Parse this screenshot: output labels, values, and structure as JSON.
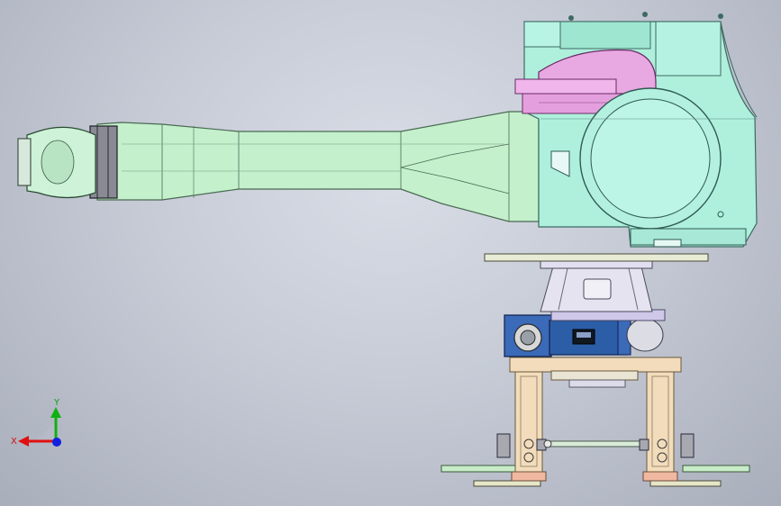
{
  "colors": {
    "background": "#c8ccd6",
    "arm": "#c4f0cc",
    "arm_edge": "#4a6a52",
    "shoulder": "#aef0dc",
    "shoulder_edge": "#3e6a62",
    "joint_ring": "#e8a8e2",
    "base_column": "#e0ddec",
    "motor": "#2c5ea8",
    "stand": "#f2dcbc",
    "foot_plate": "#c8ecc8",
    "axis_x": "#e01010",
    "axis_y": "#10b010",
    "axis_z": "#1020e0"
  },
  "icons": {
    "triad": "coordinate-triad-icon"
  },
  "triad": {
    "y_label": "Y",
    "x_label": "X"
  }
}
